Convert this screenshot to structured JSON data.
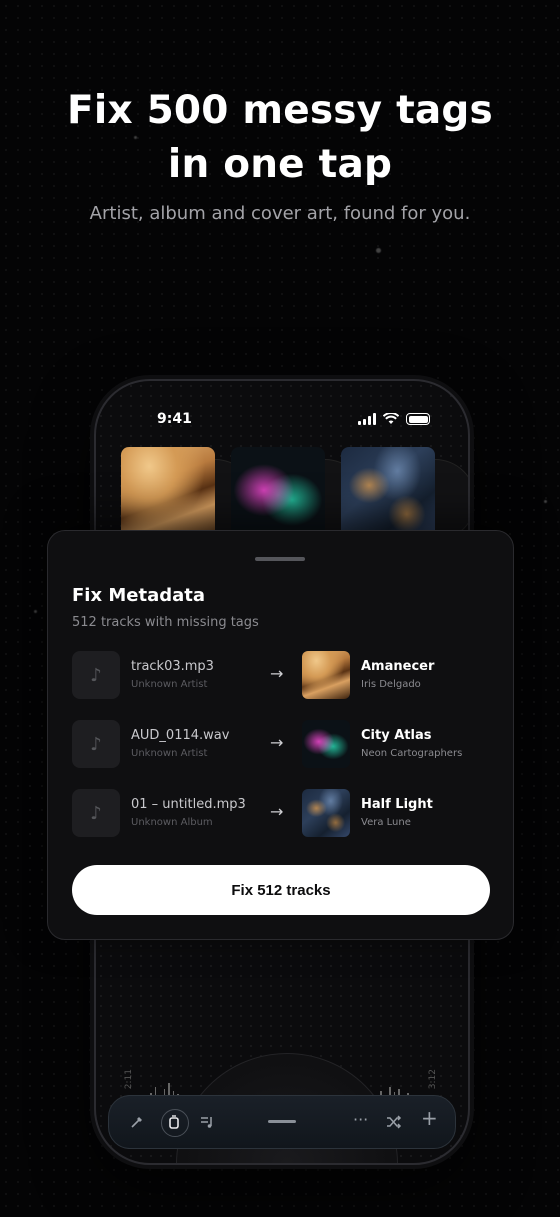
{
  "hero": {
    "title_line1": "Fix 500 messy tags",
    "title_line2": "in one tap",
    "subtitle": "Artist, album and cover art, found for you."
  },
  "phone": {
    "status_time": "9:41",
    "times": {
      "left": "2:11",
      "right": "3:12"
    },
    "dock": {
      "icons": [
        "brush-icon",
        "library-icon",
        "queue-icon",
        "handle-icon",
        "more-icon",
        "shuffle-icon",
        "plus-icon"
      ]
    }
  },
  "sheet": {
    "title": "Fix Metadata",
    "subtitle": "512 tracks with missing tags",
    "rows": [
      {
        "file": "track03.mp3",
        "file_sub": "Unknown Artist",
        "title": "Amanecer",
        "artist": "Iris Delgado"
      },
      {
        "file": "AUD_0114.wav",
        "file_sub": "Unknown Artist",
        "title": "City Atlas",
        "artist": "Neon Cartographers"
      },
      {
        "file": "01 – untitled.mp3",
        "file_sub": "Unknown Album",
        "title": "Half Light",
        "artist": "Vera Lune"
      }
    ],
    "button_label": "Fix 512 tracks"
  }
}
